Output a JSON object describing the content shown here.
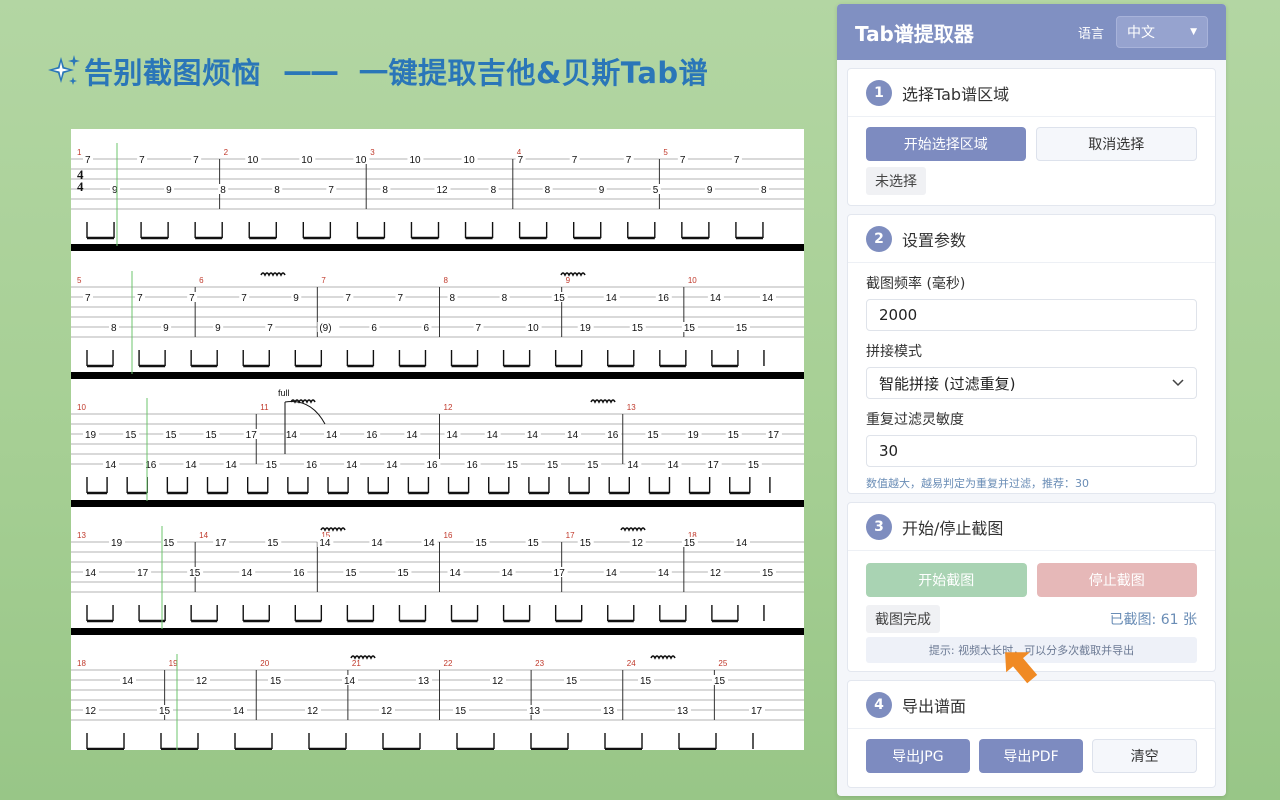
{
  "headline": {
    "text_left": "告别截图烦恼",
    "dash": "——",
    "text_right": "一键提取吉他&贝斯Tab谱"
  },
  "tab_sheet": {
    "rows": [
      {
        "measure_numbers": [
          "1",
          "2",
          "3",
          "4",
          "5"
        ],
        "notes": [
          "7",
          "9",
          "7",
          "9",
          "7",
          "8",
          "10",
          "8",
          "10",
          "7",
          "10",
          "8",
          "10",
          "12",
          "10",
          "8",
          "7",
          "8",
          "7",
          "9",
          "7",
          "5",
          "7",
          "9",
          "7",
          "8"
        ]
      },
      {
        "measure_numbers": [
          "5",
          "6",
          "7",
          "8",
          "9",
          "10"
        ],
        "notes": [
          "7",
          "8",
          "7",
          "9",
          "7",
          "9",
          "7",
          "7",
          "9",
          "(9)",
          "7",
          "6",
          "7",
          "6",
          "8",
          "7",
          "8",
          "10",
          "15",
          "19",
          "14",
          "15",
          "16",
          "15",
          "14",
          "15",
          "14"
        ]
      },
      {
        "measure_numbers": [
          "10",
          "11",
          "12",
          "13"
        ],
        "annotation": "full",
        "notes": [
          "19",
          "14",
          "15",
          "16",
          "15",
          "14",
          "15",
          "14",
          "17",
          "15",
          "14",
          "16",
          "14",
          "14",
          "16",
          "14",
          "14",
          "16",
          "14",
          "16",
          "14",
          "15",
          "14",
          "15",
          "14",
          "15",
          "16",
          "14",
          "15",
          "14",
          "19",
          "17",
          "15",
          "15",
          "17"
        ]
      },
      {
        "measure_numbers": [
          "13",
          "14",
          "15",
          "16",
          "17",
          "18"
        ],
        "notes": [
          "14",
          "19",
          "17",
          "15",
          "15",
          "17",
          "14",
          "15",
          "16",
          "14",
          "15",
          "14",
          "15",
          "14",
          "14",
          "15",
          "14",
          "15",
          "17",
          "15",
          "14",
          "12",
          "14",
          "15",
          "12",
          "14",
          "15"
        ]
      },
      {
        "measure_numbers": [
          "18",
          "19",
          "20",
          "21",
          "22",
          "23",
          "24",
          "25"
        ],
        "notes": [
          "12",
          "14",
          "15",
          "12",
          "14",
          "15",
          "12",
          "14",
          "12",
          "13",
          "15",
          "12",
          "13",
          "15",
          "13",
          "15",
          "13",
          "15",
          "17"
        ]
      }
    ]
  },
  "panel": {
    "title": "Tab谱提取器",
    "language_label": "语言",
    "language_value": "中文",
    "steps": [
      {
        "number": "1",
        "title": "选择Tab谱区域",
        "start_button": "开始选择区域",
        "cancel_button": "取消选择",
        "status": "未选择"
      },
      {
        "number": "2",
        "title": "设置参数",
        "interval_label": "截图频率 (毫秒)",
        "interval_value": "2000",
        "mode_label": "拼接模式",
        "mode_value": "智能拼接 (过滤重复)",
        "sensitivity_label": "重复过滤灵敏度",
        "sensitivity_value": "30",
        "sensitivity_hint": "数值越大，越易判定为重复并过滤，推荐：30"
      },
      {
        "number": "3",
        "title": "开始/停止截图",
        "start_button": "开始截图",
        "stop_button": "停止截图",
        "status": "截图完成",
        "count_text": "已截图: 61 张",
        "tip": "提示: 视频太长时，可以分多次截取并导出"
      },
      {
        "number": "4",
        "title": "导出谱面",
        "export_jpg": "导出JPG",
        "export_pdf": "导出PDF",
        "clear": "清空"
      }
    ]
  },
  "colors": {
    "background": "#a6cf94",
    "headline": "#2a76b8",
    "panel_header": "#8090c2",
    "primary": "#7d8bc0",
    "arrow": "#f08a24"
  }
}
